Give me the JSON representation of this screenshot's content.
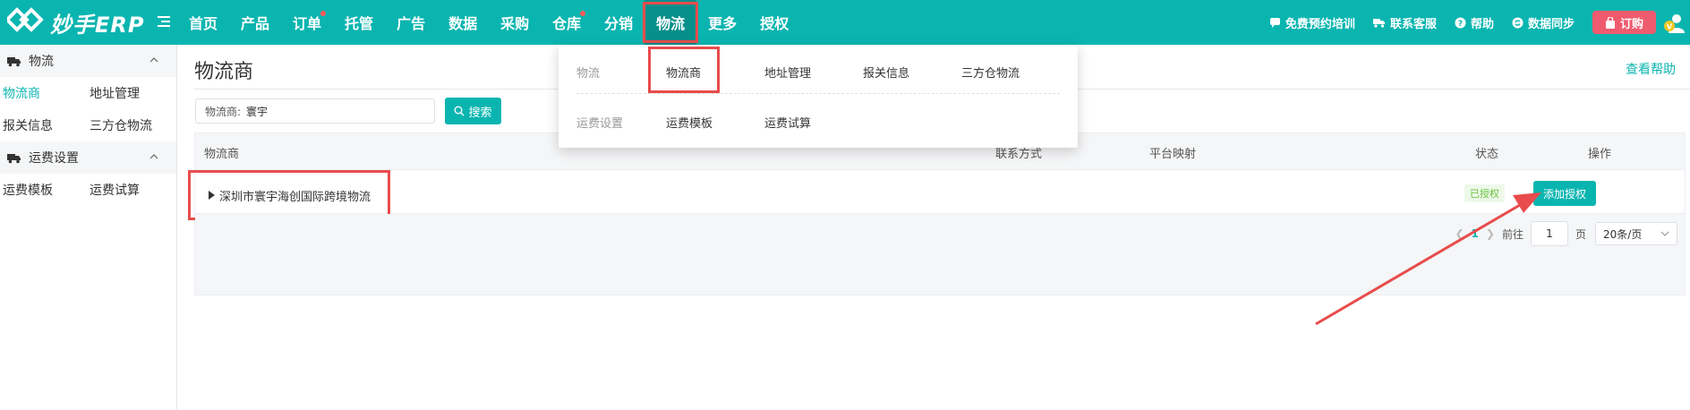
{
  "brand": {
    "name": "妙手ERP"
  },
  "nav": {
    "items": [
      {
        "label": "首页",
        "dot": false
      },
      {
        "label": "产品",
        "dot": false
      },
      {
        "label": "订单",
        "dot": true
      },
      {
        "label": "托管",
        "dot": false
      },
      {
        "label": "广告",
        "dot": false
      },
      {
        "label": "数据",
        "dot": false
      },
      {
        "label": "采购",
        "dot": false
      },
      {
        "label": "仓库",
        "dot": true
      },
      {
        "label": "分销",
        "dot": false
      },
      {
        "label": "物流",
        "dot": false,
        "active": true
      },
      {
        "label": "更多",
        "dot": false
      },
      {
        "label": "授权",
        "dot": false
      }
    ]
  },
  "topright": {
    "training": "免费预约培训",
    "service": "联系客服",
    "help": "帮助",
    "sync": "数据同步",
    "order": "订购"
  },
  "sidebar": {
    "group1": {
      "title": "物流",
      "items": [
        "物流商",
        "地址管理",
        "报关信息",
        "三方仓物流"
      ]
    },
    "group2": {
      "title": "运费设置",
      "items": [
        "运费模板",
        "运费试算"
      ]
    }
  },
  "page": {
    "title": "物流商",
    "help_link": "查看帮助"
  },
  "search": {
    "label": "物流商:",
    "value": "寰宇",
    "button": "搜索"
  },
  "table": {
    "columns": [
      "物流商",
      "联系方式",
      "平台映射",
      "状态",
      "操作"
    ],
    "rows": [
      {
        "name": "深圳市寰宇海创国际跨境物流",
        "status": "已授权",
        "action": "添加授权"
      }
    ]
  },
  "pagination": {
    "current": "1",
    "goto_label": "前往",
    "page_input": "1",
    "page_unit": "页",
    "page_size": "20条/页"
  },
  "dropdown": {
    "row1_group": "物流",
    "row1_items": [
      "物流商",
      "地址管理",
      "报关信息",
      "三方仓物流"
    ],
    "row2_group": "运费设置",
    "row2_items": [
      "运费模板",
      "运费试算"
    ]
  },
  "colors": {
    "primary": "#0ab5b0",
    "active_nav": "#078f8b",
    "order_button": "#ef5b6e",
    "annotation": "#e84c4c"
  }
}
